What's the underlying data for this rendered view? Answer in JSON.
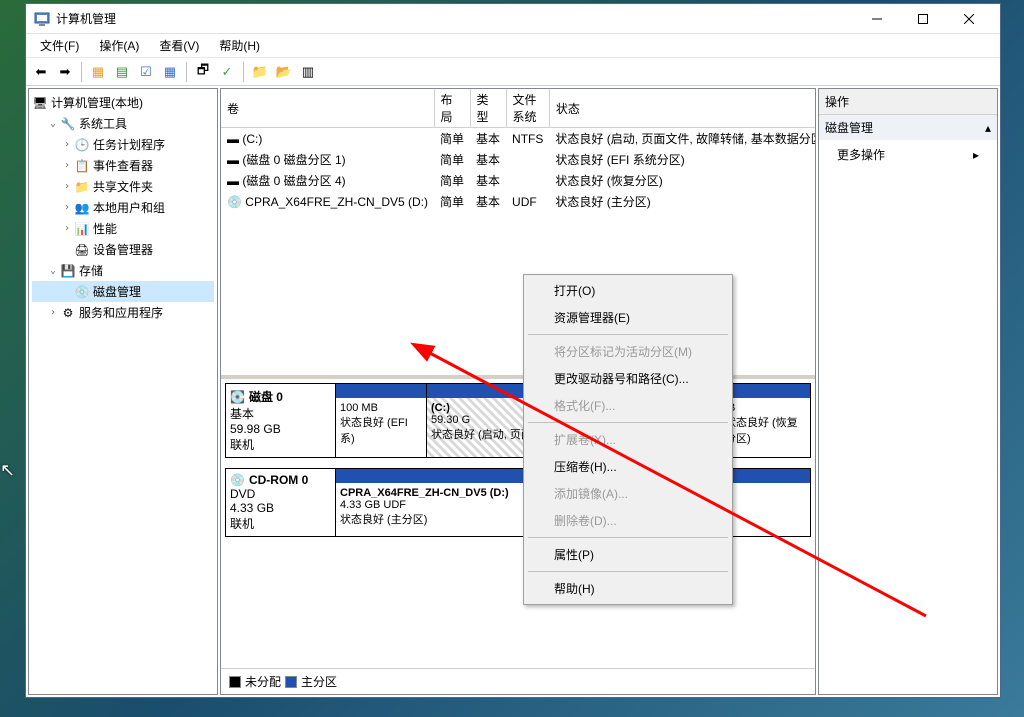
{
  "window": {
    "title": "计算机管理"
  },
  "menu": {
    "file": "文件(F)",
    "action": "操作(A)",
    "view": "查看(V)",
    "help": "帮助(H)"
  },
  "tree": {
    "root": "计算机管理(本地)",
    "systools": "系统工具",
    "scheduler": "任务计划程序",
    "eventviewer": "事件查看器",
    "shared": "共享文件夹",
    "users": "本地用户和组",
    "perf": "性能",
    "devmgr": "设备管理器",
    "storage": "存储",
    "diskmgmt": "磁盘管理",
    "services": "服务和应用程序"
  },
  "cols": {
    "volume": "卷",
    "layout": "布局",
    "type": "类型",
    "fs": "文件系统",
    "status": "状态"
  },
  "rows": [
    {
      "vol": "(C:)",
      "layout": "简单",
      "type": "基本",
      "fs": "NTFS",
      "status": "状态良好 (启动, 页面文件, 故障转储, 基本数据分区)"
    },
    {
      "vol": "(磁盘 0 磁盘分区 1)",
      "layout": "简单",
      "type": "基本",
      "fs": "",
      "status": "状态良好 (EFI 系统分区)"
    },
    {
      "vol": "(磁盘 0 磁盘分区 4)",
      "layout": "简单",
      "type": "基本",
      "fs": "",
      "status": "状态良好 (恢复分区)"
    },
    {
      "vol": "CPRA_X64FRE_ZH-CN_DV5 (D:)",
      "layout": "简单",
      "type": "基本",
      "fs": "UDF",
      "status": "状态良好 (主分区)"
    }
  ],
  "disk0": {
    "name": "磁盘 0",
    "kind": "基本",
    "size": "59.98 GB",
    "state": "联机",
    "p1": {
      "size": "100 MB",
      "status": "状态良好 (EFI 系)"
    },
    "p2": {
      "name": "(C:)",
      "size": "59.30 G",
      "status": "状态良好 (启动, 页面文件, 故障转储, 基本数"
    },
    "p3": {
      "size": "IB",
      "status": "状态良好 (恢复分区)"
    }
  },
  "cdrom": {
    "name": "CD-ROM 0",
    "kind": "DVD",
    "size": "4.33 GB",
    "state": "联机",
    "p1": {
      "name": "CPRA_X64FRE_ZH-CN_DV5  (D:)",
      "size": "4.33 GB UDF",
      "status": "状态良好 (主分区)"
    }
  },
  "legend": {
    "unalloc": "未分配",
    "primary": "主分区"
  },
  "actions": {
    "header": "操作",
    "diskmgmt": "磁盘管理",
    "more": "更多操作"
  },
  "ctx": {
    "open": "打开(O)",
    "explorer": "资源管理器(E)",
    "markactive": "将分区标记为活动分区(M)",
    "changeletter": "更改驱动器号和路径(C)...",
    "format": "格式化(F)...",
    "extend": "扩展卷(X)...",
    "shrink": "压缩卷(H)...",
    "addmirror": "添加镜像(A)...",
    "delete": "删除卷(D)...",
    "properties": "属性(P)",
    "help": "帮助(H)"
  }
}
